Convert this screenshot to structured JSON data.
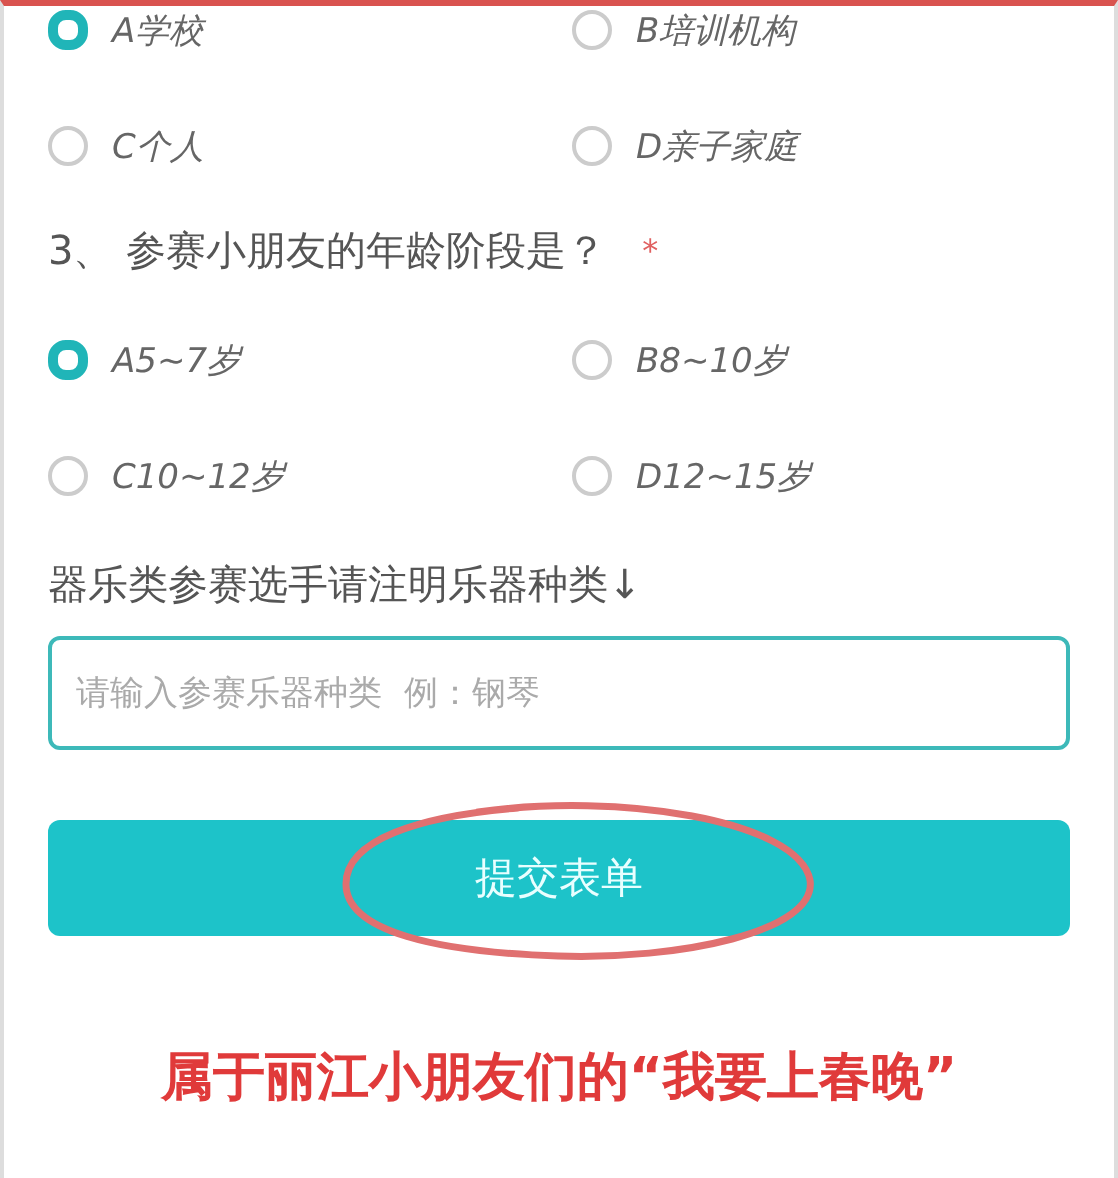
{
  "org_options": [
    {
      "label": "A学校",
      "selected": true
    },
    {
      "label": "B培训机构",
      "selected": false
    },
    {
      "label": "C个人",
      "selected": false
    },
    {
      "label": "D亲子家庭",
      "selected": false
    }
  ],
  "question": {
    "text": "3、 参赛小朋友的年龄阶段是？",
    "required_mark": "*"
  },
  "age_options": [
    {
      "label": "A5~7岁",
      "selected": true
    },
    {
      "label": "B8~10岁",
      "selected": false
    },
    {
      "label": "C10~12岁",
      "selected": false
    },
    {
      "label": "D12~15岁",
      "selected": false
    }
  ],
  "instrument": {
    "label": "器乐类参赛选手请注明乐器种类↓",
    "placeholder": "请输入参赛乐器种类  例：钢琴"
  },
  "submit": "提交表单",
  "caption": "属于丽江小朋友们的“我要上春晚”"
}
